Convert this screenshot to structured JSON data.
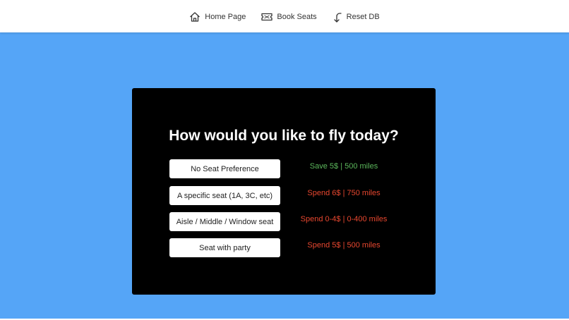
{
  "nav": {
    "items": [
      {
        "label": "Home Page",
        "icon": "home-icon"
      },
      {
        "label": "Book Seats",
        "icon": "ticket-icon"
      },
      {
        "label": "Reset DB",
        "icon": "reset-arrow-icon"
      }
    ]
  },
  "card": {
    "headline": "How would you like to fly today?",
    "options": [
      {
        "label": "No Seat Preference",
        "price": "Save 5$ | 500 miles",
        "price_color": "#5cb85c"
      },
      {
        "label": "A specific seat (1A, 3C, etc)",
        "price": "Spend 6$ | 750 miles",
        "price_color": "#e8472f"
      },
      {
        "label": "Aisle / Middle / Window seat",
        "price": "Spend 0-4$ | 0-400 miles",
        "price_color": "#e8472f"
      },
      {
        "label": "Seat with party",
        "price": "Spend 5$ | 500 miles",
        "price_color": "#e8472f"
      }
    ]
  },
  "colors": {
    "background": "#55a5f7",
    "card": "#000000",
    "save": "#5cb85c",
    "spend": "#e8472f"
  }
}
